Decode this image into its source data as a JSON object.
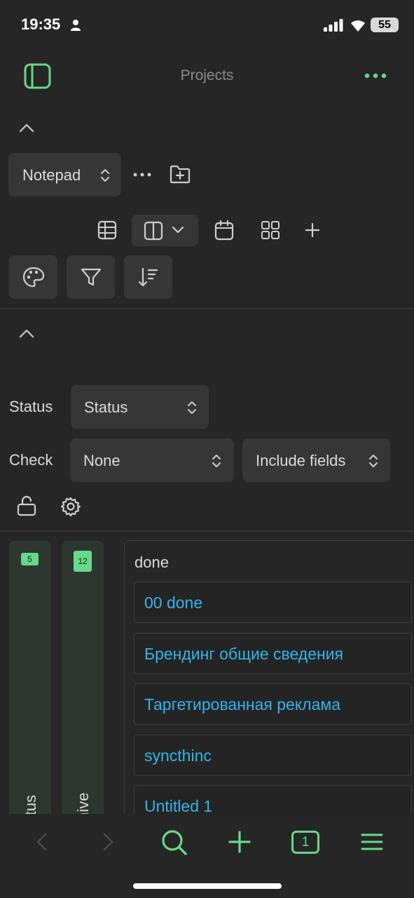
{
  "status_bar": {
    "time": "19:35",
    "battery": "55"
  },
  "nav": {
    "title": "Projects"
  },
  "toolbar": {
    "notepad_select": "Notepad"
  },
  "views": {
    "icons": [
      "table-icon",
      "board-icon",
      "calendar-icon",
      "gallery-icon",
      "add-icon"
    ],
    "active": "board-icon"
  },
  "settings": {
    "status_label": "Status",
    "status_value": "Status",
    "check_label": "Check",
    "check_value": "None",
    "include_fields": "Include fields"
  },
  "board": {
    "collapsed_columns": [
      {
        "name": "No status",
        "count": "5"
      },
      {
        "name": "Archive",
        "count": "12"
      }
    ],
    "column": {
      "title": "done",
      "cards": [
        "00 done",
        "Брендинг общие сведения",
        "Таргетированная реклама",
        "syncthinc",
        "Untitled 1"
      ]
    }
  },
  "bottom": {
    "tab_count": "1"
  },
  "colors": {
    "accent": "#67d98a",
    "link": "#34b5ec",
    "background": "#262626",
    "button": "#363636"
  }
}
